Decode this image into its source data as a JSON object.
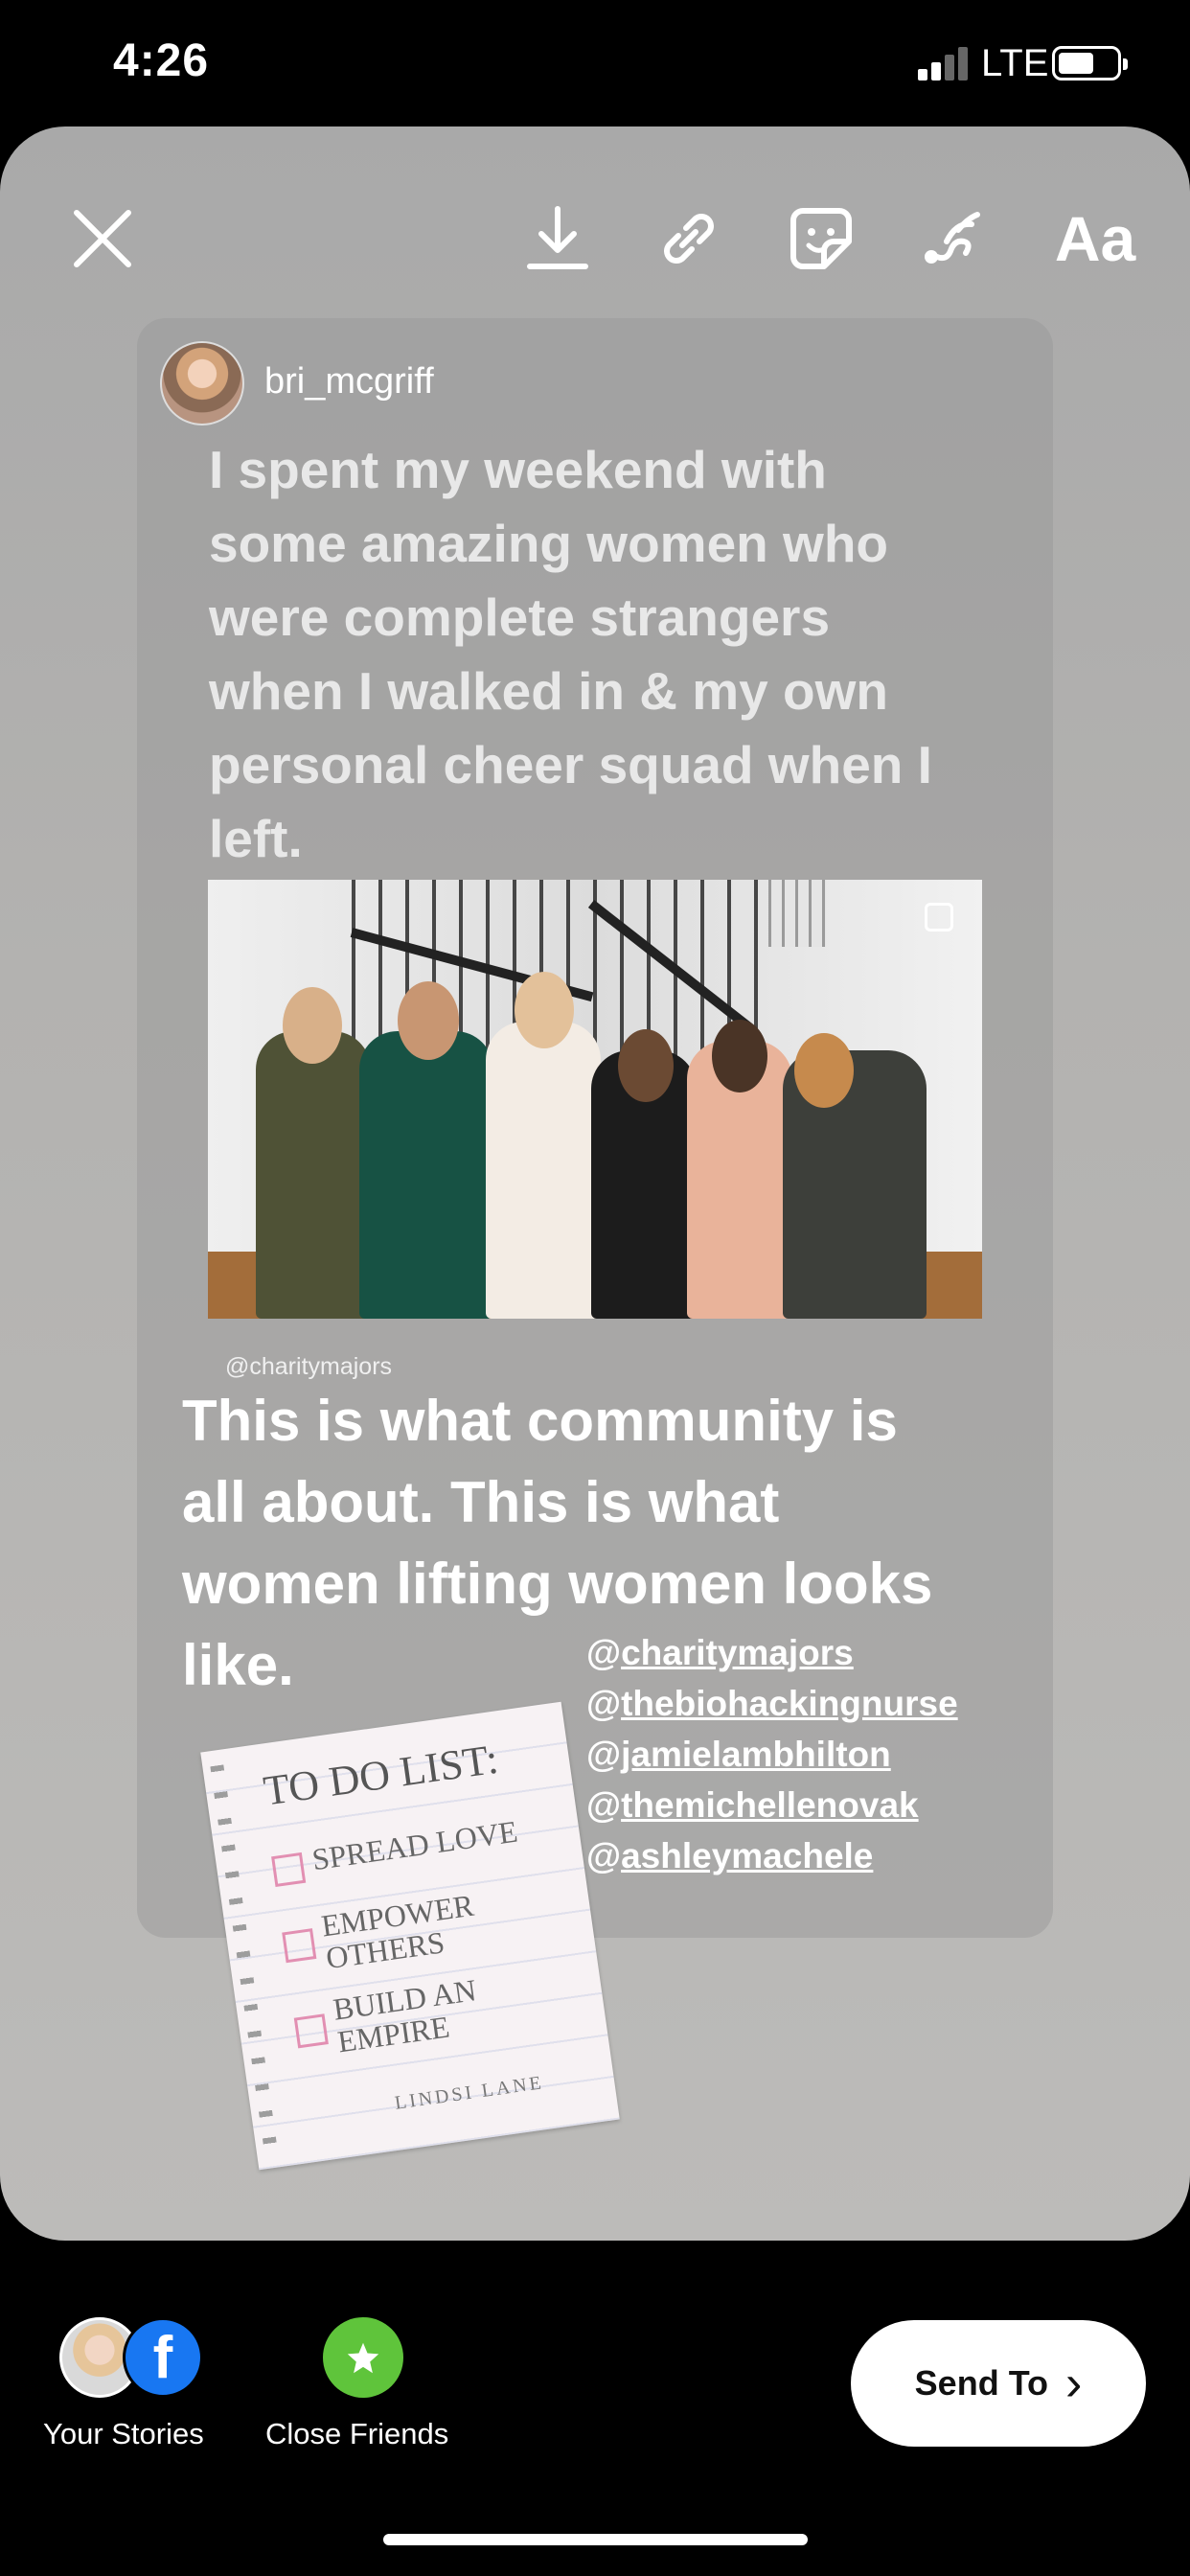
{
  "status": {
    "time": "4:26",
    "network": "LTE"
  },
  "toolbar": {
    "close": "close-icon",
    "download": "download-icon",
    "link": "link-icon",
    "sticker": "sticker-icon",
    "draw": "draw-icon",
    "text": "Aa"
  },
  "post": {
    "username": "bri_mcgriff",
    "text": "I spent my weekend with some amazing women who were complete strangers when I walked in & my own personal cheer squad when I left.",
    "photo_credit": "@charitymajors"
  },
  "overlay": {
    "caption": "This is what community is all about. This is what women lifting women looks like.",
    "mentions": [
      "charitymajors",
      "thebiohackingnurse",
      "jamielambhilton",
      "themichellenovak",
      "ashleymachele"
    ]
  },
  "sticker": {
    "title": "TO DO LIST:",
    "items": [
      "SPREAD LOVE",
      "EMPOWER OTHERS",
      "BUILD AN EMPIRE"
    ],
    "signature": "LINDSI LANE"
  },
  "bottom": {
    "your_stories": "Your Stories",
    "close_friends": "Close Friends",
    "send_to": "Send To"
  },
  "colors": {
    "close_friends": "#5fc43b",
    "facebook": "#1877f2"
  }
}
